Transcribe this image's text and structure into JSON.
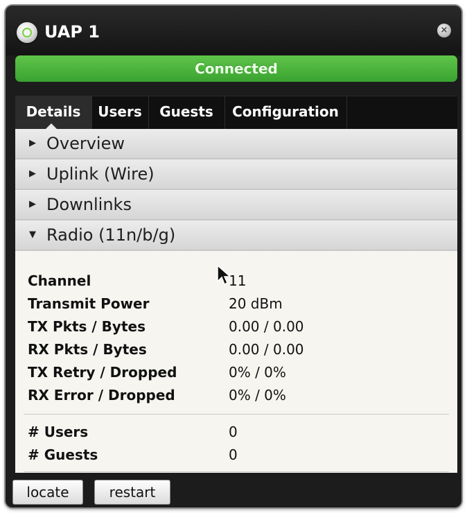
{
  "window": {
    "title": "UAP 1",
    "status": "Connected",
    "status_color": "#4cb63d",
    "close_icon": "×"
  },
  "tabs": [
    {
      "label": "Details",
      "active": true
    },
    {
      "label": "Users",
      "active": false
    },
    {
      "label": "Guests",
      "active": false
    },
    {
      "label": "Configuration",
      "active": false
    }
  ],
  "sections": [
    {
      "label": "Overview",
      "expanded": false,
      "arrow": "▶"
    },
    {
      "label": "Uplink (Wire)",
      "expanded": false,
      "arrow": "▶"
    },
    {
      "label": "Downlinks",
      "expanded": false,
      "arrow": "▶"
    },
    {
      "label": "Radio (11n/b/g)",
      "expanded": true,
      "arrow": "▼"
    }
  ],
  "radio": {
    "rows": [
      {
        "key": "Channel",
        "value": "11"
      },
      {
        "key": "Transmit Power",
        "value": "20 dBm"
      },
      {
        "key": "TX Pkts / Bytes",
        "value": "0.00 / 0.00"
      },
      {
        "key": "RX Pkts / Bytes",
        "value": "0.00 / 0.00"
      },
      {
        "key": "TX Retry / Dropped",
        "value": "0% / 0%"
      },
      {
        "key": "RX Error / Dropped",
        "value": "0% / 0%"
      }
    ],
    "counts": [
      {
        "key": "# Users",
        "value": "0"
      },
      {
        "key": "# Guests",
        "value": "0"
      }
    ]
  },
  "footer": {
    "locate_label": "locate",
    "restart_label": "restart"
  }
}
